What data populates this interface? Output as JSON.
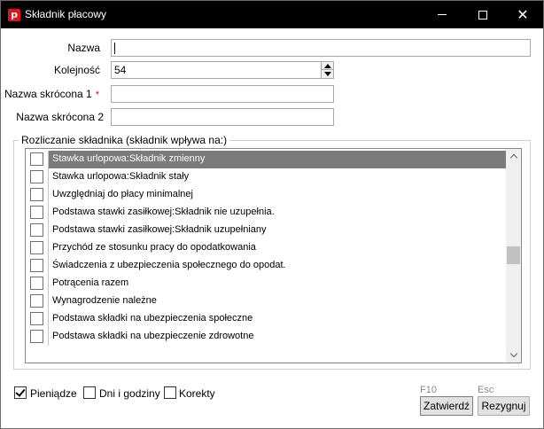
{
  "window": {
    "title": "Składnik płacowy",
    "app_icon_letter": "p"
  },
  "form": {
    "nazwa_label": "Nazwa",
    "nazwa_value": "",
    "kolejnosc_label": "Kolejność",
    "kolejnosc_value": "54",
    "skrocona1_label": "Nazwa skrócona 1",
    "skrocona1_required": "*",
    "skrocona1_value": "",
    "skrocona2_label": "Nazwa skrócona 2",
    "skrocona2_value": ""
  },
  "group": {
    "title": "Rozliczanie składnika (składnik wpływa na:)",
    "items": [
      {
        "label": "Stawka urlopowa:Składnik zmienny",
        "checked": false,
        "selected": true
      },
      {
        "label": "Stawka urlopowa:Składnik stały",
        "checked": false,
        "selected": false
      },
      {
        "label": "Uwzględniaj do płacy minimalnej",
        "checked": false,
        "selected": false
      },
      {
        "label": "Podstawa stawki zasiłkowej:Składnik nie uzupełnia.",
        "checked": false,
        "selected": false
      },
      {
        "label": "Podstawa stawki zasiłkowej:Składnik uzupełniany",
        "checked": false,
        "selected": false
      },
      {
        "label": "Przychód ze stosunku pracy do opodatkowania",
        "checked": false,
        "selected": false
      },
      {
        "label": "Świadczenia z ubezpieczenia społecznego do opodat.",
        "checked": false,
        "selected": false
      },
      {
        "label": "Potrącenia razem",
        "checked": false,
        "selected": false
      },
      {
        "label": "Wynagrodzenie należne",
        "checked": false,
        "selected": false
      },
      {
        "label": "Podstawa składki na ubezpieczenia społeczne",
        "checked": false,
        "selected": false
      },
      {
        "label": "Podstawa składki na ubezpieczenie zdrowotne",
        "checked": false,
        "selected": false
      }
    ]
  },
  "footer": {
    "pieniadze_label": "Pieniądze",
    "pieniadze_checked": true,
    "dni_label": "Dni i godziny",
    "dni_checked": false,
    "korekty_label": "Korekty",
    "korekty_checked": false,
    "zatwierdz_hotkey": "F10",
    "zatwierdz_label": "Zatwierdź",
    "rezygnuj_hotkey": "Esc",
    "rezygnuj_label": "Rezygnuj"
  },
  "colors": {
    "titlebar": "#000000",
    "app_icon": "#e1141e",
    "selection": "#7b7b7b",
    "required_mark": "#dd0000"
  }
}
